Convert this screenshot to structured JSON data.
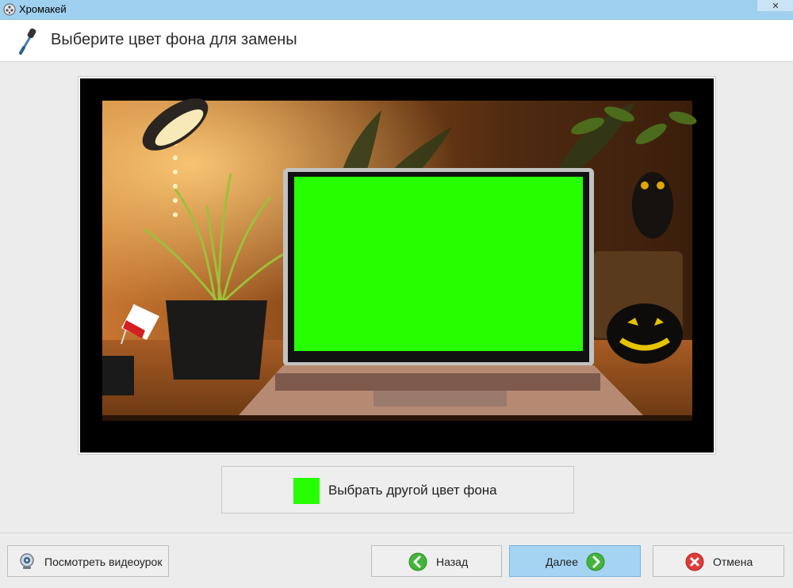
{
  "window": {
    "title": "Хромакей",
    "close_glyph": "✕"
  },
  "header": {
    "title": "Выберите цвет фона для замены",
    "icon": "pipette-icon"
  },
  "preview": {
    "screen_color": "#27ff00"
  },
  "choose_color": {
    "label": "Выбрать другой цвет фона",
    "swatch_color": "#27ff00"
  },
  "footer": {
    "video_label": "Посмотреть видеоурок",
    "back_label": "Назад",
    "next_label": "Далее",
    "cancel_label": "Отмена"
  }
}
